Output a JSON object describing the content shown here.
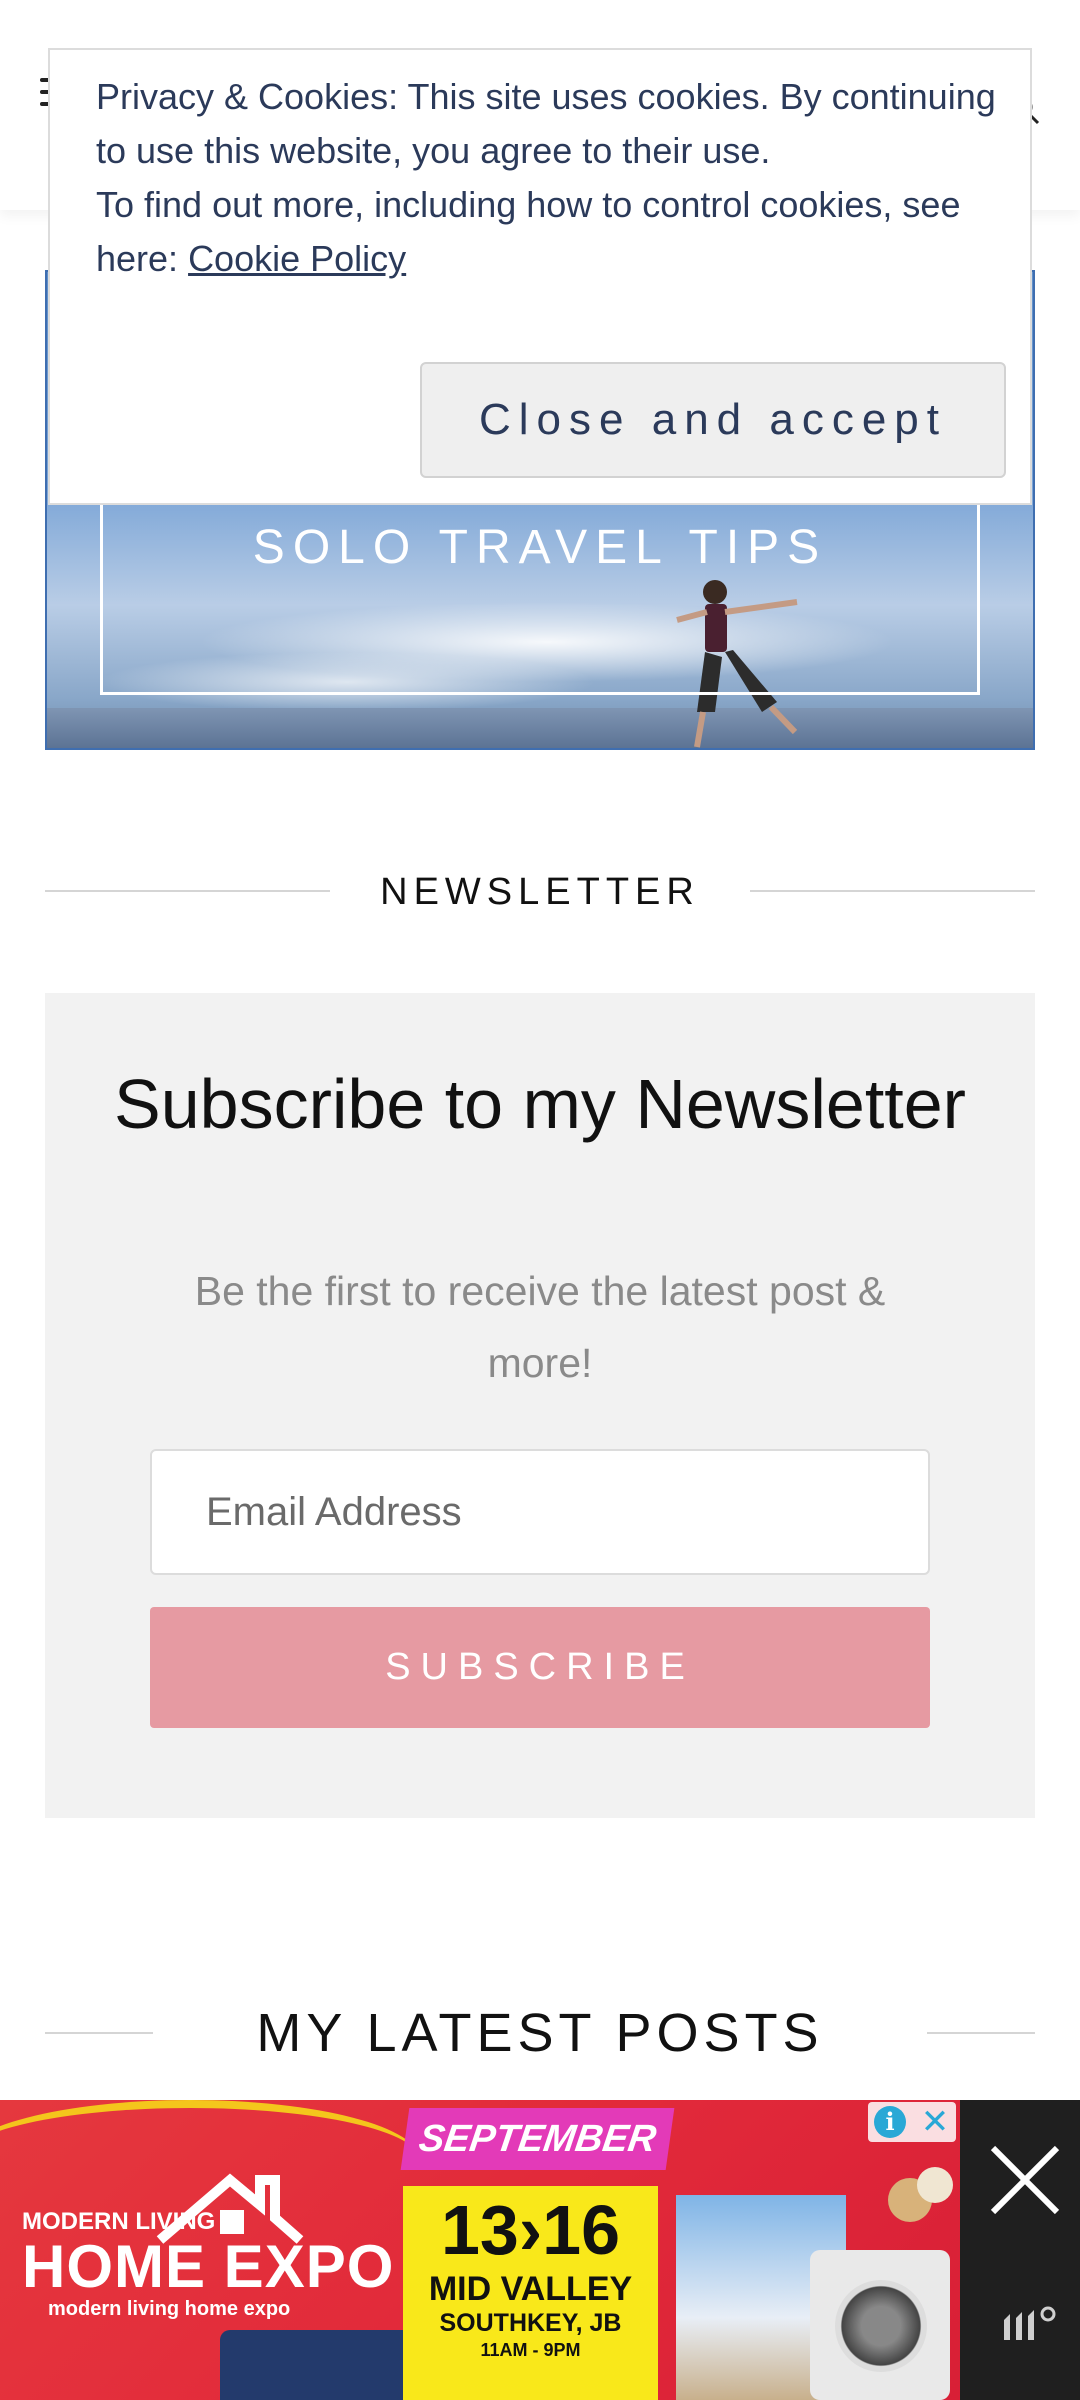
{
  "cookie_banner": {
    "text_line1": "Privacy & Cookies: This site uses cookies. By continuing to use this website, you agree to their use.",
    "text_line2": "To find out more, including how to control cookies, see here: ",
    "link_label": "Cookie Policy",
    "button_label": "Close and accept"
  },
  "hero": {
    "title": "SOLO TRAVEL TIPS"
  },
  "newsletter": {
    "section_label": "NEWSLETTER",
    "title": "Subscribe to my Newsletter",
    "subtitle": "Be the first to receive the latest post & more!",
    "email_placeholder": "Email Address",
    "button_label": "SUBSCRIBE",
    "button_color": "#e69aa2"
  },
  "latest_posts": {
    "section_label": "MY LATEST POSTS"
  },
  "ad": {
    "brand_small": "MODERN LIVING",
    "brand_big": "HOME EXPO",
    "social": "modern living home expo",
    "month": "SEPTEMBER",
    "dates": "13›16",
    "venue": "MID VALLEY",
    "venue_sub": "SOUTHKEY, JB",
    "hours": "11AM - 9PM",
    "info_icon": "info-icon",
    "close_icon": "close-icon"
  }
}
